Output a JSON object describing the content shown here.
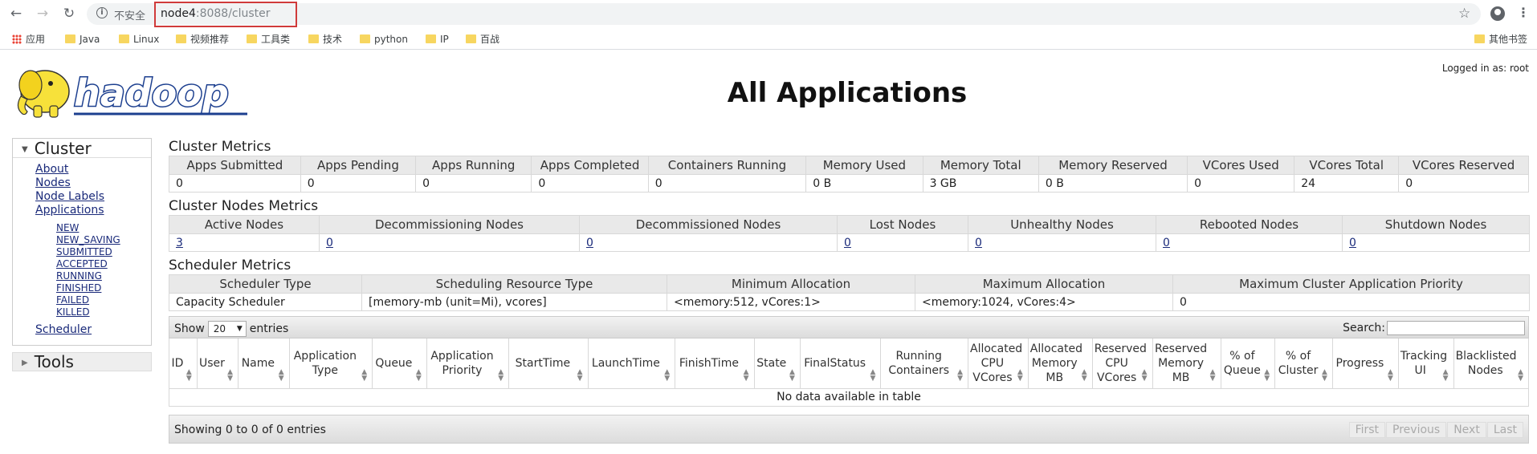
{
  "browser": {
    "insecure_label": "不安全",
    "url_host": "node4",
    "url_rest": ":8088/cluster",
    "bookmarks": [
      "应用",
      "Java",
      "Linux",
      "视频推荐",
      "工具类",
      "技术",
      "python",
      "IP",
      "百战"
    ],
    "other_bookmarks": "其他书签"
  },
  "header": {
    "logo_text": "hadoop",
    "title": "All Applications",
    "logged_in": "Logged in as: root"
  },
  "sidebar": {
    "cluster_label": "Cluster",
    "links": [
      "About",
      "Nodes",
      "Node Labels",
      "Applications"
    ],
    "states": [
      "NEW",
      "NEW_SAVING",
      "SUBMITTED",
      "ACCEPTED",
      "RUNNING",
      "FINISHED",
      "FAILED",
      "KILLED"
    ],
    "scheduler_link": "Scheduler",
    "tools_label": "Tools"
  },
  "cluster_metrics": {
    "title": "Cluster Metrics",
    "headers": [
      "Apps Submitted",
      "Apps Pending",
      "Apps Running",
      "Apps Completed",
      "Containers Running",
      "Memory Used",
      "Memory Total",
      "Memory Reserved",
      "VCores Used",
      "VCores Total",
      "VCores Reserved"
    ],
    "values": [
      "0",
      "0",
      "0",
      "0",
      "0",
      "0 B",
      "3 GB",
      "0 B",
      "0",
      "24",
      "0"
    ]
  },
  "nodes_metrics": {
    "title": "Cluster Nodes Metrics",
    "headers": [
      "Active Nodes",
      "Decommissioning Nodes",
      "Decommissioned Nodes",
      "Lost Nodes",
      "Unhealthy Nodes",
      "Rebooted Nodes",
      "Shutdown Nodes"
    ],
    "values": [
      "3",
      "0",
      "0",
      "0",
      "0",
      "0",
      "0"
    ]
  },
  "scheduler_metrics": {
    "title": "Scheduler Metrics",
    "headers": [
      "Scheduler Type",
      "Scheduling Resource Type",
      "Minimum Allocation",
      "Maximum Allocation",
      "Maximum Cluster Application Priority"
    ],
    "values": [
      "Capacity Scheduler",
      "[memory-mb (unit=Mi), vcores]",
      "<memory:512, vCores:1>",
      "<memory:1024, vCores:4>",
      "0"
    ]
  },
  "apps_table": {
    "show_label": "Show",
    "entries_value": "20",
    "entries_label": "entries",
    "search_label": "Search:",
    "columns": [
      "ID",
      "User",
      "Name",
      "Application Type",
      "Queue",
      "Application Priority",
      "StartTime",
      "LaunchTime",
      "FinishTime",
      "State",
      "FinalStatus",
      "Running Containers",
      "Allocated CPU VCores",
      "Allocated Memory MB",
      "Reserved CPU VCores",
      "Reserved Memory MB",
      "% of Queue",
      "% of Cluster",
      "Progress",
      "Tracking UI",
      "Blacklisted Nodes"
    ],
    "empty_message": "No data available in table",
    "info": "Showing 0 to 0 of 0 entries",
    "pager": [
      "First",
      "Previous",
      "Next",
      "Last"
    ]
  }
}
